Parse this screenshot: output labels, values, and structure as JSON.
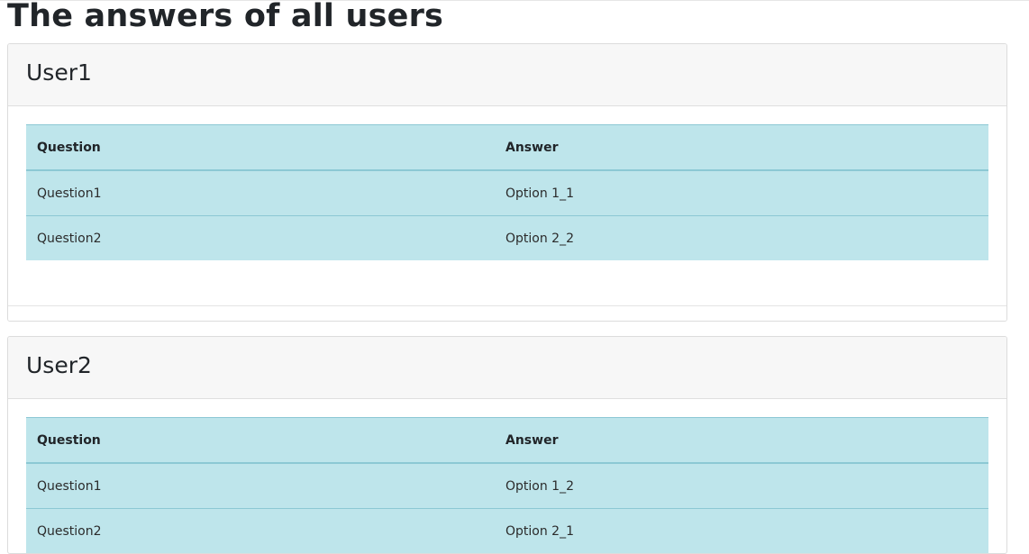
{
  "page": {
    "title": "The answers of all users"
  },
  "users": [
    {
      "name": "User1",
      "headers": {
        "question": "Question",
        "answer": "Answer"
      },
      "rows": [
        {
          "question": "Question1",
          "answer": "Option 1_1"
        },
        {
          "question": "Question2",
          "answer": "Option 2_2"
        }
      ]
    },
    {
      "name": "User2",
      "headers": {
        "question": "Question",
        "answer": "Answer"
      },
      "rows": [
        {
          "question": "Question1",
          "answer": "Option 1_2"
        },
        {
          "question": "Question2",
          "answer": "Option 2_1"
        }
      ]
    }
  ],
  "colors": {
    "table_bg": "#bee5eb",
    "table_border": "#8cc8d4",
    "card_header_bg": "#f7f7f7"
  }
}
